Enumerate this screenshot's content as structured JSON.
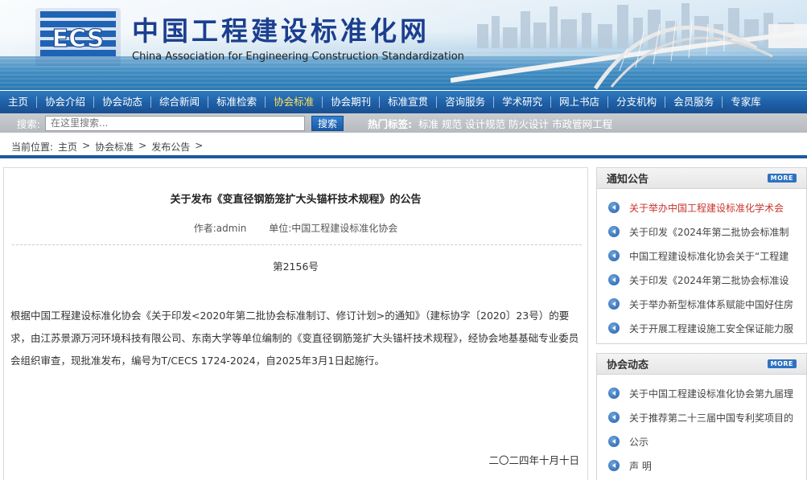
{
  "header": {
    "logo_text": "ECS",
    "title_cn": "中国工程建设标准化网",
    "title_en": "China Association for Engineering Construction Standardization"
  },
  "nav": {
    "items": [
      {
        "label": "主页"
      },
      {
        "label": "协会介绍"
      },
      {
        "label": "协会动态"
      },
      {
        "label": "综合新闻"
      },
      {
        "label": "标准检索"
      },
      {
        "label": "协会标准",
        "active": true
      },
      {
        "label": "协会期刊"
      },
      {
        "label": "标准宣贯"
      },
      {
        "label": "咨询服务"
      },
      {
        "label": "学术研究"
      },
      {
        "label": "网上书店"
      },
      {
        "label": "分支机构"
      },
      {
        "label": "会员服务"
      },
      {
        "label": "专家库"
      }
    ],
    "active_color": "#ffe25a"
  },
  "search": {
    "label": "搜索:",
    "placeholder": "在这里搜索...",
    "button": "搜索",
    "hot_label": "热门标签:",
    "hot_tags": [
      "标准",
      "规范",
      "设计规范",
      "防火设计",
      "市政管网工程"
    ]
  },
  "breadcrumb": {
    "prefix": "当前位置:",
    "items": [
      "主页",
      "协会标准",
      "发布公告"
    ],
    "sep": ">"
  },
  "article": {
    "title": "关于发布《变直径钢筋笼扩大头锚杆技术规程》的公告",
    "author": "作者:admin",
    "unit": "单位:中国工程建设标准化协会",
    "number": "第2156号",
    "body": "根据中国工程建设标准化协会《关于印发<2020年第二批协会标准制订、修订计划>的通知》（建标协字〔2020〕23号）的要求，由江苏景源万河环境科技有限公司、东南大学等单位编制的《变直径钢筋笼扩大头锚杆技术规程》，经协会地基基础专业委员会组织审查，现批准发布，编号为T/CECS 1724-2024，自2025年3月1日起施行。",
    "date": "二〇二四年十月十日"
  },
  "notices": {
    "title": "通知公告",
    "more": "MORE",
    "items": [
      "关于举办中国工程建设标准化学术会",
      "关于印发《2024年第二批协会标准制",
      "中国工程建设标准化协会关于“工程建",
      "关于印发《2024年第二批协会标准设",
      "关于举办新型标准体系赋能中国好住房",
      "关于开展工程建设施工安全保证能力服"
    ]
  },
  "news": {
    "title": "协会动态",
    "more": "MORE",
    "items": [
      "关于中国工程建设标准化协会第九届理",
      "关于推荐第二十三届中国专利奖项目的",
      "公示",
      "声 明"
    ]
  },
  "colors": {
    "nav_blue": "#1e5fa6",
    "rule_blue": "#1c5a9e",
    "highlight_red": "#c8342c"
  }
}
